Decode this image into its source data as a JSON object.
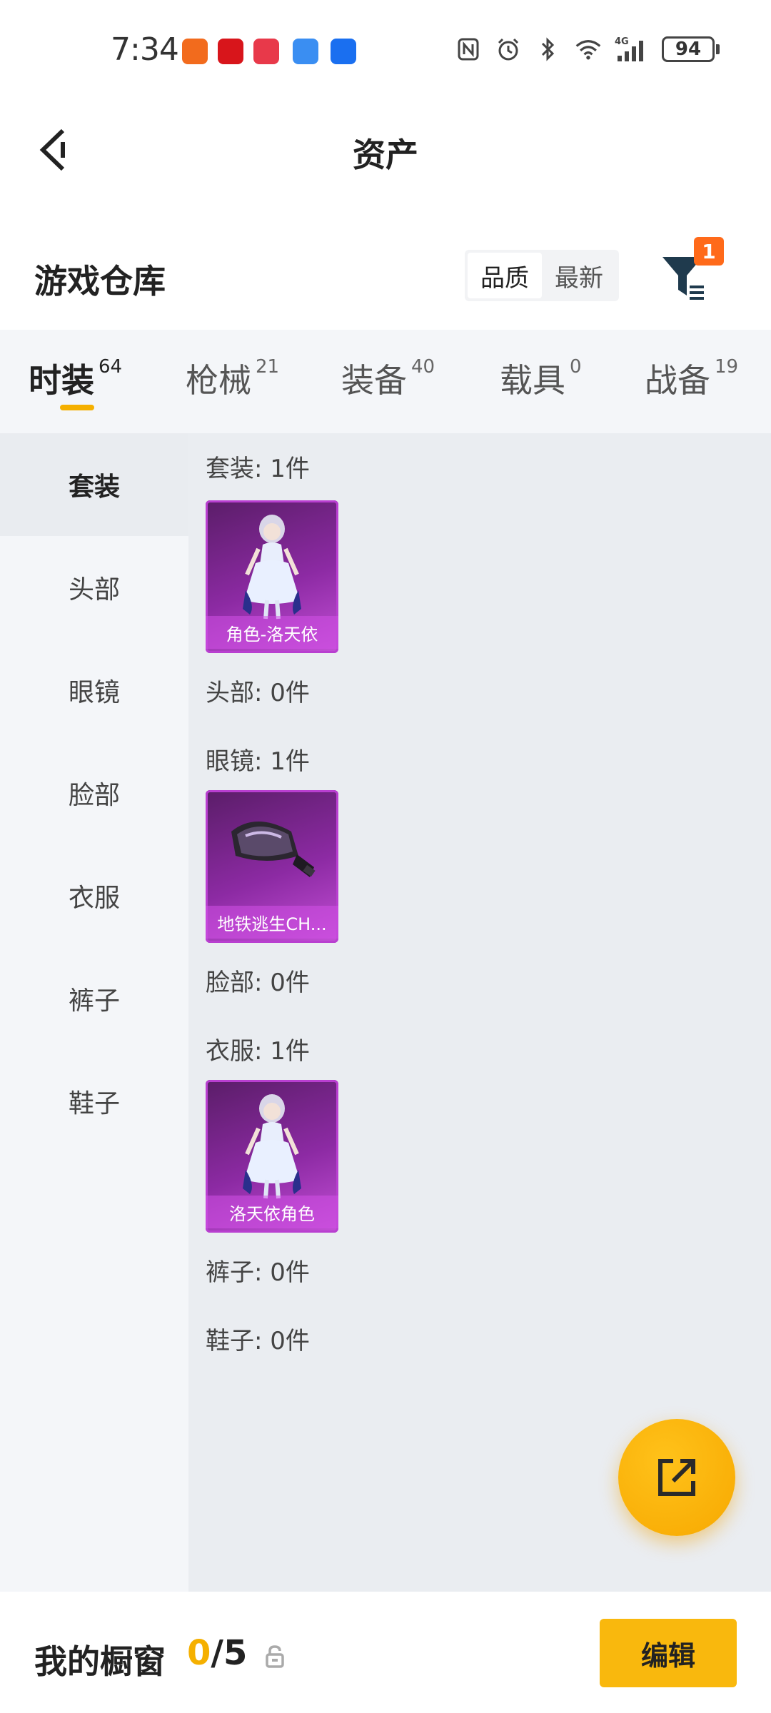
{
  "status_bar": {
    "time": "7:34",
    "battery": "94",
    "network": "4G"
  },
  "header": {
    "title": "资产"
  },
  "warehouse": {
    "title": "游戏仓库",
    "sort_options": [
      "品质",
      "最新"
    ],
    "sort_active": "品质",
    "filter_badge": "1"
  },
  "tabs": [
    {
      "label": "时装",
      "count": "64",
      "active": true
    },
    {
      "label": "枪械",
      "count": "21",
      "active": false
    },
    {
      "label": "装备",
      "count": "40",
      "active": false
    },
    {
      "label": "载具",
      "count": "0",
      "active": false
    },
    {
      "label": "战备",
      "count": "19",
      "active": false
    }
  ],
  "categories": [
    {
      "label": "套装",
      "active": true
    },
    {
      "label": "头部",
      "active": false
    },
    {
      "label": "眼镜",
      "active": false
    },
    {
      "label": "脸部",
      "active": false
    },
    {
      "label": "衣服",
      "active": false
    },
    {
      "label": "裤子",
      "active": false
    },
    {
      "label": "鞋子",
      "active": false
    }
  ],
  "sections": [
    {
      "label": "套装: 1件",
      "item": "角色-洛天依"
    },
    {
      "label": "头部: 0件"
    },
    {
      "label": "眼镜: 1件",
      "item": "地铁逃生CH..."
    },
    {
      "label": "脸部: 0件"
    },
    {
      "label": "衣服: 1件",
      "item": "洛天依角色"
    },
    {
      "label": "裤子: 0件"
    },
    {
      "label": "鞋子: 0件"
    }
  ],
  "bottom": {
    "window_label": "我的橱窗",
    "window_current": "0",
    "window_total": "/5",
    "edit_label": "编辑"
  },
  "colors": {
    "accent": "#f5b000",
    "badge": "#ff6a1a",
    "item_purple": "#8c2aa3"
  },
  "icons": [
    "back-arrow-icon",
    "filter-icon",
    "share-export-icon",
    "lock-icon"
  ]
}
